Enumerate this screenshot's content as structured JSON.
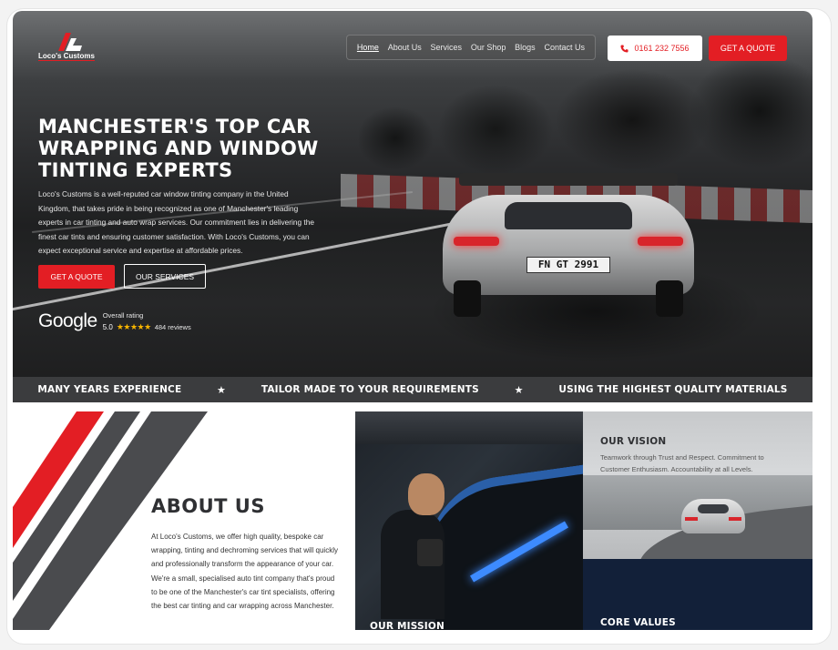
{
  "brand": {
    "name": "Loco's Customs"
  },
  "nav": {
    "items": [
      {
        "label": "Home",
        "active": true
      },
      {
        "label": "About Us"
      },
      {
        "label": "Services"
      },
      {
        "label": "Our Shop"
      },
      {
        "label": "Blogs"
      },
      {
        "label": "Contact Us"
      }
    ]
  },
  "header": {
    "phone": "0161 232 7556",
    "quote_label": "GET A QUOTE"
  },
  "hero": {
    "title": "MANCHESTER'S TOP CAR WRAPPING AND WINDOW TINTING EXPERTS",
    "intro": "Loco's Customs is a well-reputed car window tinting company in the United Kingdom, that takes pride in being recognized as one of Manchester's leading experts in car tinting and auto wrap services. Our commitment lies in delivering the finest car tints and ensuring customer satisfaction. With Loco's Customs, you can expect exceptional service and expertise at affordable prices.",
    "primary_button": "GET A QUOTE",
    "secondary_button": "OUR SERVICES",
    "car_plate": "FN GT 2991",
    "rating": {
      "provider": "Google",
      "label": "Overall rating",
      "score": "5.0",
      "stars": "★★★★★",
      "reviews": "484 reviews"
    }
  },
  "strip": {
    "items": [
      "MANY YEARS EXPERIENCE",
      "TAILOR MADE TO YOUR REQUIREMENTS",
      "USING THE HIGHEST QUALITY MATERIALS"
    ],
    "separator": "★"
  },
  "about": {
    "title": "ABOUT US",
    "body": "At Loco's Customs, we offer high quality, bespoke car wrapping, tinting and dechroming services that will quickly and professionally transform the appearance of your car. We're a small, specialised auto tint company that's proud to be one of the Manchester's car tint specialists, offering the best car tinting and car wrapping across Manchester."
  },
  "mission": {
    "title": "OUR MISSION"
  },
  "vision": {
    "title": "OUR VISION",
    "body": "Teamwork through Trust and Respect. Commitment to Customer Enthusiasm. Accountability at all Levels."
  },
  "values": {
    "title": "CORE VALUES"
  },
  "colors": {
    "accent": "#e31e24",
    "navy": "#122039",
    "dark": "#3b3c3e"
  }
}
